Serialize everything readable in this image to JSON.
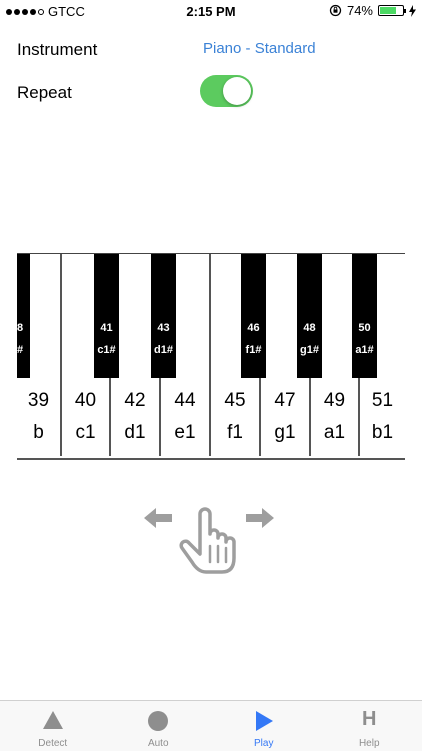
{
  "status_bar": {
    "carrier": "GTCC",
    "time": "2:15 PM",
    "battery_percent": "74%",
    "battery_level": 0.74
  },
  "settings": {
    "instrument_label": "Instrument",
    "instrument_value": "Piano - Standard",
    "repeat_label": "Repeat",
    "repeat_on": true
  },
  "piano": {
    "white_keys": [
      {
        "num": "39",
        "name": "b"
      },
      {
        "num": "40",
        "name": "c1"
      },
      {
        "num": "42",
        "name": "d1"
      },
      {
        "num": "44",
        "name": "e1"
      },
      {
        "num": "45",
        "name": "f1"
      },
      {
        "num": "47",
        "name": "g1"
      },
      {
        "num": "49",
        "name": "a1"
      },
      {
        "num": "51",
        "name": "b1"
      }
    ],
    "black_keys": [
      {
        "num": "8",
        "name": "#"
      },
      {
        "num": "41",
        "name": "c1#"
      },
      {
        "num": "43",
        "name": "d1#"
      },
      {
        "num": "46",
        "name": "f1#"
      },
      {
        "num": "48",
        "name": "g1#"
      },
      {
        "num": "50",
        "name": "a1#"
      }
    ]
  },
  "tabs": [
    {
      "label": "Detect",
      "icon": "triangle-icon",
      "active": false
    },
    {
      "label": "Auto",
      "icon": "circle-icon",
      "active": false
    },
    {
      "label": "Play",
      "icon": "play-icon",
      "active": true
    },
    {
      "label": "Help",
      "icon": "help-h-icon",
      "active": false
    }
  ],
  "colors": {
    "accent": "#3478f6",
    "link": "#3b82d6",
    "toggle_on": "#5ccb5f"
  }
}
